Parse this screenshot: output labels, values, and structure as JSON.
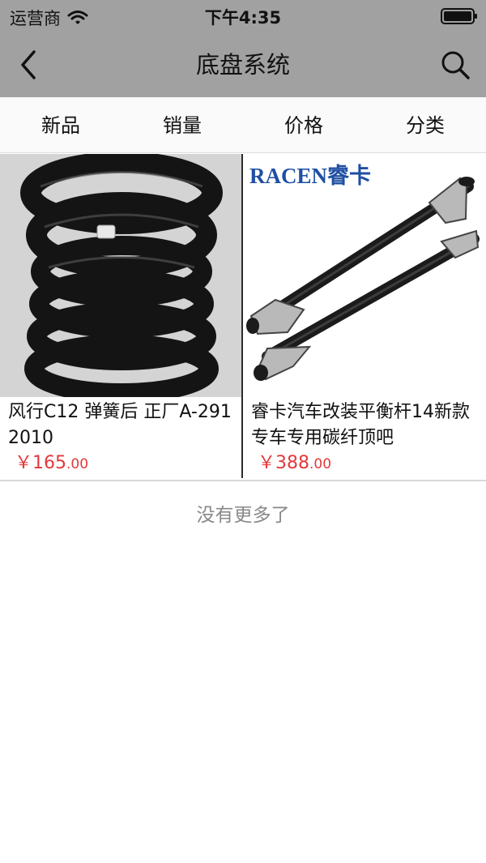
{
  "status_bar": {
    "carrier": "运营商",
    "time": "下午4:35",
    "icons": [
      "wifi-icon",
      "battery-icon"
    ]
  },
  "nav": {
    "title": "底盘系统",
    "icons": [
      "back-arrow-icon",
      "search-icon"
    ]
  },
  "sort_tabs": [
    {
      "label": "新品"
    },
    {
      "label": "销量"
    },
    {
      "label": "价格"
    },
    {
      "label": "分类"
    }
  ],
  "products": [
    {
      "title": "风行C12 弹簧后 正厂A-2912010",
      "currency": "￥",
      "price_int": "165",
      "price_dec": ".00",
      "image": "coil-spring-photo"
    },
    {
      "title": "睿卡汽车改装平衡杆14新款专车专用碳纤顶吧",
      "currency": "￥",
      "price_int": "388",
      "price_dec": ".00",
      "image": "strut-bar-photo",
      "image_brand": "RACEN睿卡"
    }
  ],
  "footer_note": "没有更多了",
  "colors": {
    "header_bg": "#a1a1a1",
    "price": "#e4393c",
    "note": "#888888"
  }
}
